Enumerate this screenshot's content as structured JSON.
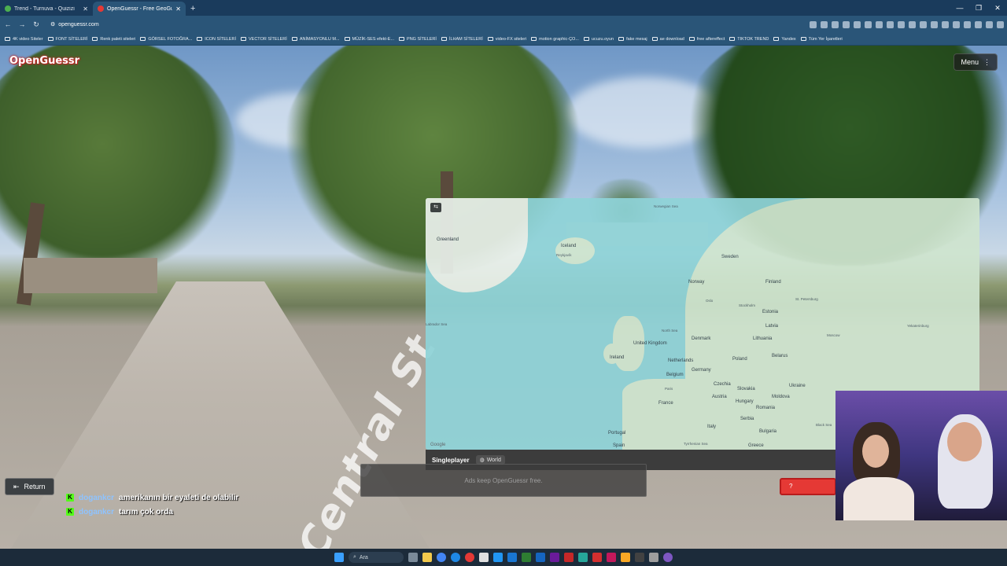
{
  "browser": {
    "tabs": [
      {
        "title": "Trend - Turnuva - Quizizi",
        "active": false
      },
      {
        "title": "OpenGuessr - Free GeoGu...",
        "active": true
      }
    ],
    "url": "openguessr.com",
    "window_controls": [
      "—",
      "❐",
      "✕"
    ],
    "bookmarks": [
      "4K video Siteler",
      "FONT SİTELERİ",
      "Renk paleti siteleri",
      "GÖRSEL FOTOĞRA...",
      "ICON SİTELERİ",
      "VECTOR SİTELERİ",
      "ANİMASYONLU M...",
      "MÜZİK-SES efekt-E...",
      "PNG SİTELERİ",
      "İLHAM SİTELERİ",
      "video-FX siteleri",
      "motion graphic-ÇO...",
      "ucuzu.oyun",
      "fake mesaj",
      "ae download",
      "free aftereffect",
      "TIKTOK TREND",
      "Yandex",
      "Tüm Yer İşaretleri"
    ]
  },
  "game": {
    "logo": "OpenGuessr",
    "menu_label": "Menu",
    "street_sign_text": "Central St",
    "map_labels": [
      {
        "text": "Greenland",
        "cls": ""
      },
      {
        "text": "Iceland",
        "cls": ""
      },
      {
        "text": "Reykjavík",
        "cls": "small"
      },
      {
        "text": "Norwegian Sea",
        "cls": "small"
      },
      {
        "text": "Sweden",
        "cls": ""
      },
      {
        "text": "Norway",
        "cls": ""
      },
      {
        "text": "Finland",
        "cls": ""
      },
      {
        "text": "Oslo",
        "cls": "small"
      },
      {
        "text": "Stockholm",
        "cls": "small"
      },
      {
        "text": "Estonia",
        "cls": ""
      },
      {
        "text": "St. Petersburg",
        "cls": "small"
      },
      {
        "text": "Latvia",
        "cls": ""
      },
      {
        "text": "Denmark",
        "cls": ""
      },
      {
        "text": "Lithuania",
        "cls": ""
      },
      {
        "text": "North Sea",
        "cls": "small"
      },
      {
        "text": "United Kingdom",
        "cls": ""
      },
      {
        "text": "Ireland",
        "cls": ""
      },
      {
        "text": "Netherlands",
        "cls": ""
      },
      {
        "text": "Germany",
        "cls": ""
      },
      {
        "text": "Poland",
        "cls": ""
      },
      {
        "text": "Belarus",
        "cls": ""
      },
      {
        "text": "Moscow",
        "cls": "small"
      },
      {
        "text": "Belgium",
        "cls": ""
      },
      {
        "text": "Czechia",
        "cls": ""
      },
      {
        "text": "Ukraine",
        "cls": ""
      },
      {
        "text": "Paris",
        "cls": "small"
      },
      {
        "text": "Slovakia",
        "cls": ""
      },
      {
        "text": "Austria",
        "cls": ""
      },
      {
        "text": "Hungary",
        "cls": ""
      },
      {
        "text": "Moldova",
        "cls": ""
      },
      {
        "text": "France",
        "cls": ""
      },
      {
        "text": "Romania",
        "cls": ""
      },
      {
        "text": "Serbia",
        "cls": ""
      },
      {
        "text": "Italy",
        "cls": ""
      },
      {
        "text": "Bulgaria",
        "cls": ""
      },
      {
        "text": "Portugal",
        "cls": ""
      },
      {
        "text": "Spain",
        "cls": ""
      },
      {
        "text": "Greece",
        "cls": ""
      },
      {
        "text": "Tyrrhenian Sea",
        "cls": "small"
      },
      {
        "text": "Black Sea",
        "cls": "small"
      },
      {
        "text": "Labrador Sea",
        "cls": "small"
      },
      {
        "text": "Yekaterinburg",
        "cls": "small"
      }
    ],
    "map_attribution": "Google",
    "mode_label": "Singleplayer",
    "map_name": "World",
    "ads_text": "Ads keep OpenGuessr free.",
    "guess_label": "?",
    "return_label": "Return"
  },
  "chat": [
    {
      "user": "dogankcr",
      "message": "amerikanın bir eyaleti de olabilir"
    },
    {
      "user": "dogankcr",
      "message": "tarım çok orda"
    }
  ],
  "taskbar": {
    "search_label": "Ara"
  }
}
